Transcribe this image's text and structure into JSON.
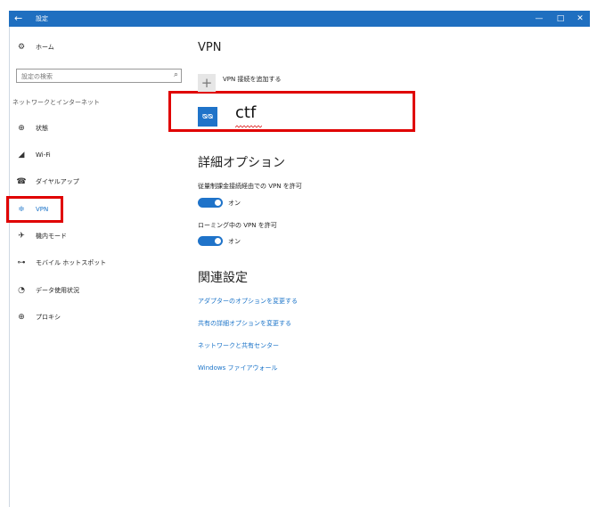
{
  "window": {
    "title": "設定",
    "back_glyph": "←",
    "minimize_glyph": "—",
    "maximize_glyph": "□",
    "close_glyph": "✕"
  },
  "sidebar": {
    "home": {
      "icon": "gear-icon",
      "glyph": "⚙",
      "label": "ホーム"
    },
    "search_placeholder": "設定の検索",
    "search_icon": "search-icon",
    "section_label": "ネットワークとインターネット",
    "items": [
      {
        "icon": "status-icon",
        "glyph": "⊕",
        "label": "状態"
      },
      {
        "icon": "wifi-icon",
        "glyph": "◢",
        "label": "Wi-Fi"
      },
      {
        "icon": "dialup-icon",
        "glyph": "☎",
        "label": "ダイヤルアップ"
      },
      {
        "icon": "vpn-icon",
        "glyph": "≑",
        "label": "VPN"
      },
      {
        "icon": "airplane-icon",
        "glyph": "✈",
        "label": "機内モード"
      },
      {
        "icon": "hotspot-icon",
        "glyph": "⊶",
        "label": "モバイル ホットスポット"
      },
      {
        "icon": "data-usage-icon",
        "glyph": "◔",
        "label": "データ使用状況"
      },
      {
        "icon": "globe-icon",
        "glyph": "⊕",
        "label": "プロキシ"
      }
    ],
    "active_item": "VPN"
  },
  "main": {
    "title": "VPN",
    "add_connection": {
      "glyph": "+",
      "label": "VPN 接続を追加する"
    },
    "connection": {
      "icon": "vpn-connection-icon",
      "glyph": "ᴓᴓ",
      "name": "ctf"
    },
    "advanced_heading": "詳細オプション",
    "options": [
      {
        "label": "従量制課金接続経由での VPN を許可",
        "state": "オン",
        "on": true
      },
      {
        "label": "ローミング中の VPN を許可",
        "state": "オン",
        "on": true
      }
    ],
    "related_heading": "関連設定",
    "links": [
      "アダプターのオプションを変更する",
      "共有の詳細オプションを変更する",
      "ネットワークと共有センター",
      "Windows ファイアウォール"
    ]
  },
  "colors": {
    "accent": "#1a73c8",
    "titlebar": "#1f6fc0",
    "highlight": "#e00000"
  }
}
